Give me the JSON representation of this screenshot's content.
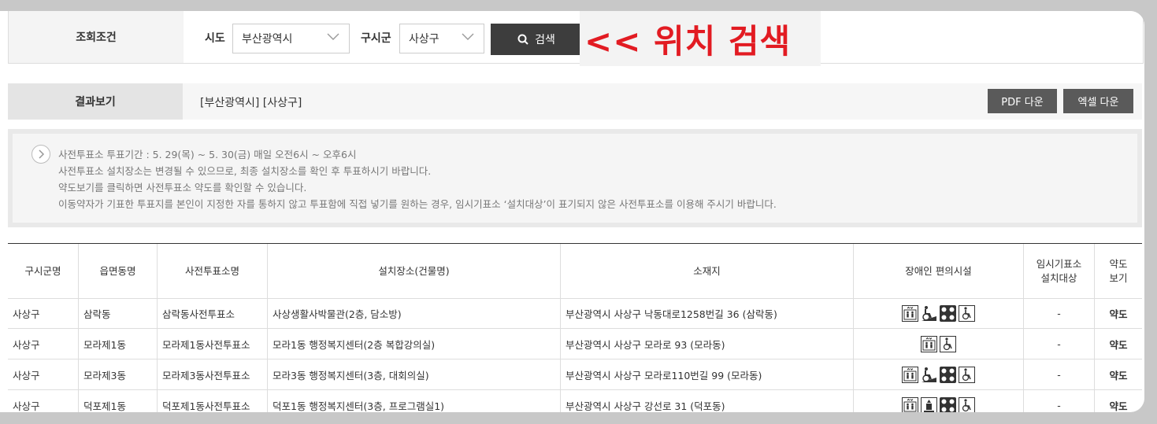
{
  "search": {
    "label": "조회조건",
    "sido_label": "시도",
    "sido_value": "부산광역시",
    "gusigun_label": "구시군",
    "gusigun_value": "사상구",
    "button_label": "검색"
  },
  "annotation": "<< 위치 검색",
  "result": {
    "label": "결과보기",
    "text": "[부산광역시] [사상구]",
    "pdf_button": "PDF 다운",
    "excel_button": "엑셀 다운"
  },
  "notice": {
    "lines": [
      "사전투표소 투표기간 : 5. 29(목) ~ 5. 30(금) 매일 오전6시 ~ 오후6시",
      "사전투표소 설치장소는 변경될 수 있으므로, 최종 설치장소를 확인 후 투표하시기 바랍니다.",
      "약도보기를 클릭하면 사전투표소 약도를 확인할 수 있습니다.",
      "이동약자가 기표한 투표지를 본인이 지정한 자를 통하지 않고 투표함에 직접 넣기를 원하는 경우, 임시기표소 ‘설치대상’이 표기되지 않은 사전투표소를 이용해 주시기 바랍니다."
    ]
  },
  "table": {
    "headers": [
      "구시군명",
      "읍면동명",
      "사전투표소명",
      "설치장소(건물명)",
      "소재지",
      "장애인 편의시설",
      "임시기표소\n설치대상",
      "약도\n보기"
    ],
    "rows": [
      {
        "gu": "사상구",
        "dong": "삼락동",
        "name": "삼락동사전투표소",
        "place": "사상생활사박물관(2층, 담소방)",
        "addr": "부산광역시 사상구 낙동대로1258번길 36 (삼락동)",
        "icons": [
          "elevator-icon",
          "wheelchair-ramp-icon",
          "braille-icon",
          "wheelchair-icon"
        ],
        "temp": "-",
        "map": "약도"
      },
      {
        "gu": "사상구",
        "dong": "모라제1동",
        "name": "모라제1동사전투표소",
        "place": "모라1동 행정복지센터(2층 복합강의실)",
        "addr": "부산광역시 사상구 모라로 93 (모라동)",
        "icons": [
          "elevator-icon",
          "wheelchair-icon"
        ],
        "temp": "-",
        "map": "약도"
      },
      {
        "gu": "사상구",
        "dong": "모라제3동",
        "name": "모라제3동사전투표소",
        "place": "모라3동 행정복지센터(3층, 대회의실)",
        "addr": "부산광역시 사상구 모라로110번길 99 (모라동)",
        "icons": [
          "elevator-icon",
          "wheelchair-ramp-icon",
          "braille-icon",
          "wheelchair-icon"
        ],
        "temp": "-",
        "map": "약도"
      },
      {
        "gu": "사상구",
        "dong": "덕포제1동",
        "name": "덕포제1동사전투표소",
        "place": "덕포1동 행정복지센터(3층, 프로그램실1)",
        "addr": "부산광역시 사상구 강선로 31 (덕포동)",
        "icons": [
          "elevator-icon",
          "lift-icon",
          "braille-icon",
          "wheelchair-icon"
        ],
        "temp": "-",
        "map": "약도"
      }
    ]
  },
  "colors": {
    "annotation": "#e21b22",
    "button": "#3d3d3d",
    "download": "#5a5a5a"
  }
}
